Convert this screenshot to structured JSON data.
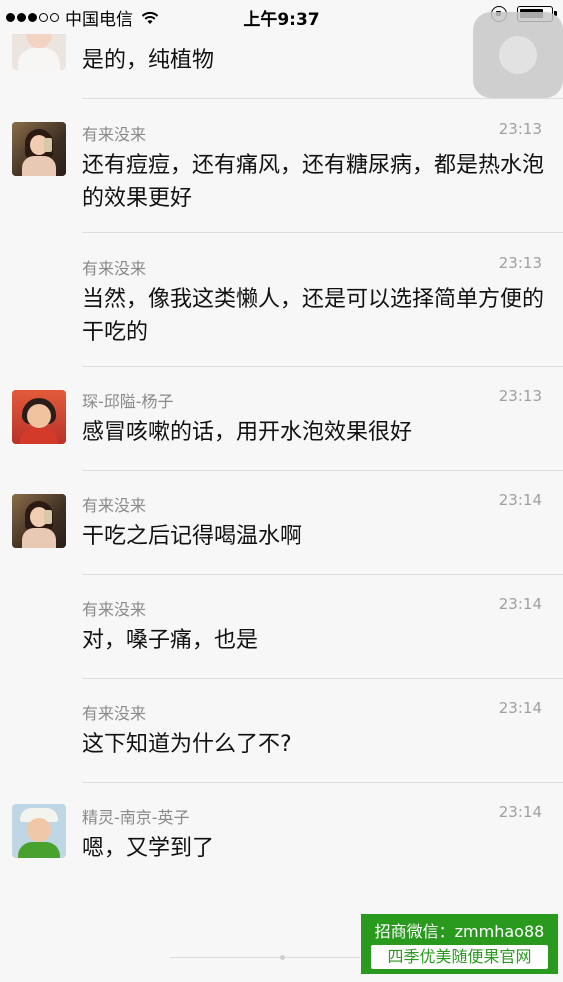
{
  "status_bar": {
    "carrier": "中国电信",
    "time": "上午9:37",
    "signal_icon": "signal-dots-icon",
    "wifi_icon": "wifi-icon",
    "rotation_lock_icon": "rotation-lock-icon",
    "battery_level": 0.8
  },
  "messages": [
    {
      "name": "",
      "time": "",
      "text": "是的，纯植物",
      "avatar": "avatar-woman-white-shirt"
    },
    {
      "name": "有来没来",
      "time": "23:13",
      "text": "还有痘痘，还有痛风，还有糖尿病，都是热水泡的效果更好",
      "avatar": "avatar-girl-phone"
    },
    {
      "name": "有来没来",
      "time": "23:13",
      "text": "当然，像我这类懒人，还是可以选择简单方便的干吃的",
      "avatar": ""
    },
    {
      "name": "琛-邱隘-杨子",
      "time": "23:13",
      "text": "感冒咳嗽的话，用开水泡效果很好",
      "avatar": "avatar-woman-red"
    },
    {
      "name": "有来没来",
      "time": "23:14",
      "text": "干吃之后记得喝温水啊",
      "avatar": "avatar-girl-phone"
    },
    {
      "name": "有来没来",
      "time": "23:14",
      "text": "对，嗓子痛，也是",
      "avatar": ""
    },
    {
      "name": "有来没来",
      "time": "23:14",
      "text": "这下知道为什么了不?",
      "avatar": ""
    },
    {
      "name": "精灵-南京-英子",
      "time": "23:14",
      "text": "嗯，又学到了",
      "avatar": "avatar-woman-green-hat"
    }
  ],
  "watermark": {
    "line1": "招商微信：zmmhao88",
    "line2": "四季优美随便果官网"
  },
  "colors": {
    "background": "#f7f7f7",
    "watermark_green": "#2a9a1f"
  }
}
